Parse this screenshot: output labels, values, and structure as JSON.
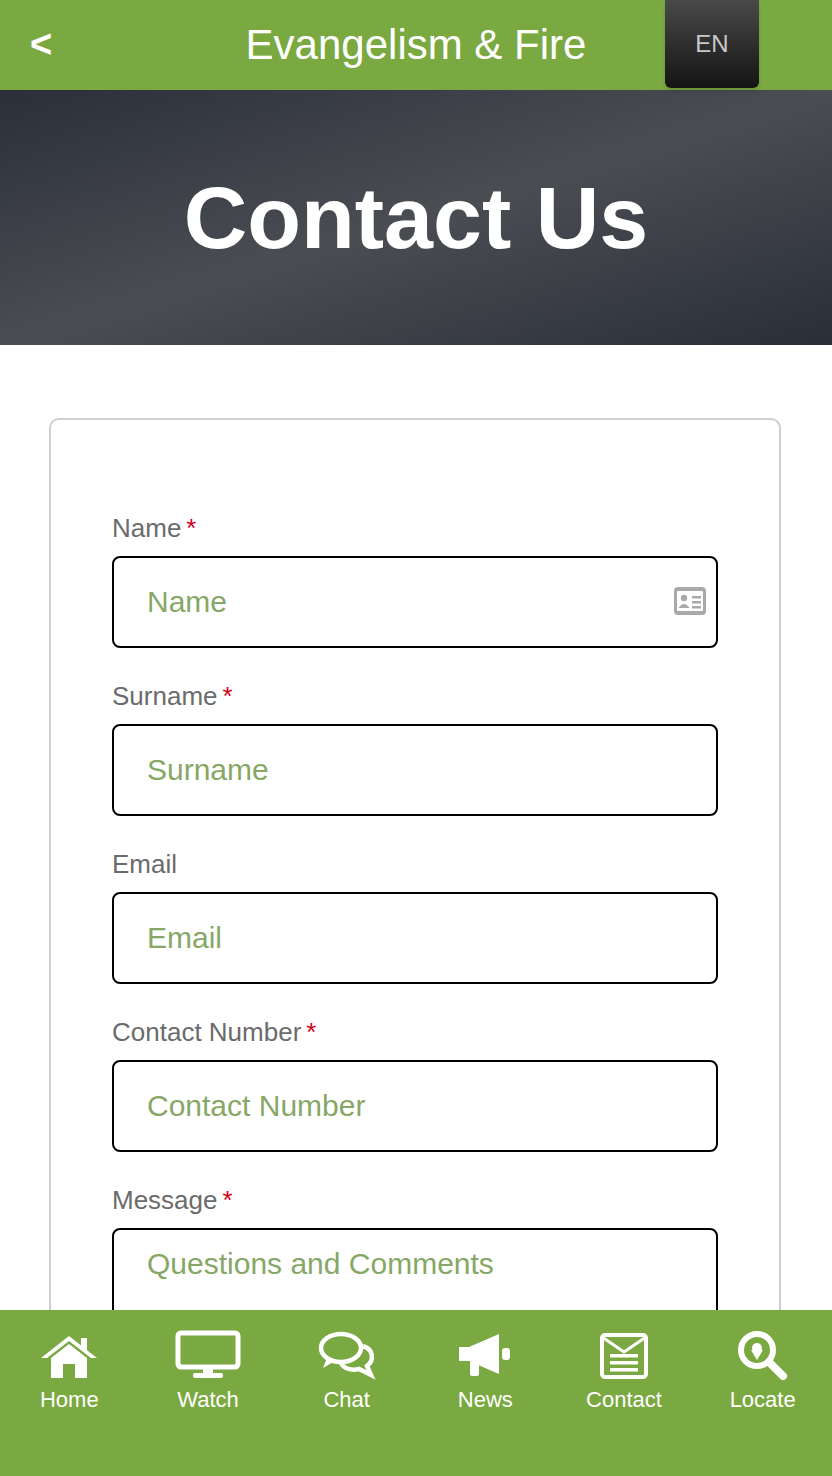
{
  "header": {
    "back": "<",
    "title": "Evangelism & Fire",
    "language": "EN"
  },
  "hero": {
    "title": "Contact Us"
  },
  "form": {
    "required_marker": "*",
    "fields": [
      {
        "label": "Name",
        "required": true,
        "placeholder": "Name",
        "kind": "input",
        "icon": true
      },
      {
        "label": "Surname",
        "required": true,
        "placeholder": "Surname",
        "kind": "input",
        "icon": false
      },
      {
        "label": "Email",
        "required": false,
        "placeholder": "Email",
        "kind": "input",
        "icon": false
      },
      {
        "label": "Contact Number",
        "required": true,
        "placeholder": "Contact Number",
        "kind": "input",
        "icon": false
      },
      {
        "label": "Message",
        "required": true,
        "placeholder": "Questions and Comments",
        "kind": "textarea",
        "icon": false
      }
    ]
  },
  "nav": [
    {
      "label": "Home",
      "icon": "home"
    },
    {
      "label": "Watch",
      "icon": "watch"
    },
    {
      "label": "Chat",
      "icon": "chat"
    },
    {
      "label": "News",
      "icon": "news"
    },
    {
      "label": "Contact",
      "icon": "contact"
    },
    {
      "label": "Locate",
      "icon": "locate"
    }
  ]
}
